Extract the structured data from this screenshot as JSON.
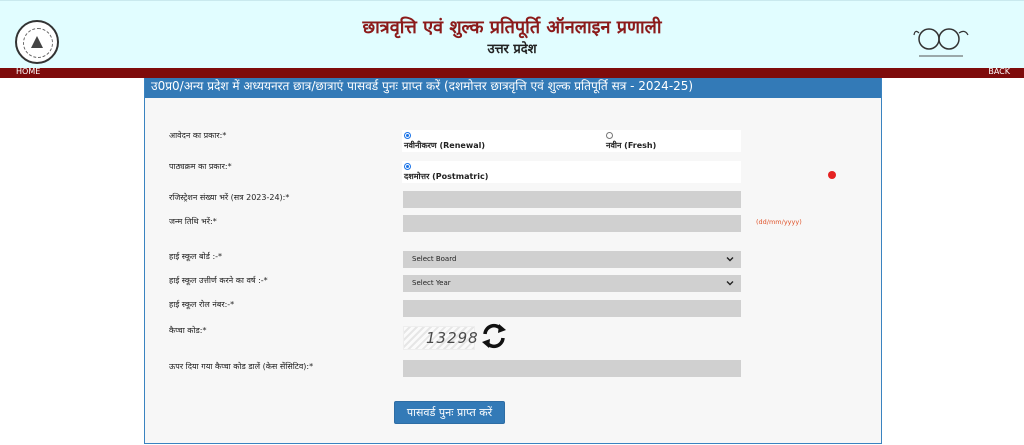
{
  "header": {
    "title": "छात्रवृत्ति एवं शुल्क प्रतिपूर्ति ऑनलाइन प्रणाली",
    "subtitle": "उत्तर प्रदेश"
  },
  "nav": {
    "home": "HOME",
    "back": "BACK"
  },
  "panel": {
    "heading": "उ0प्र0/अन्य प्रदेश में अध्ययनरत छात्र/छात्राएं पासवर्ड पुनः प्राप्त करें (दशमोत्तर छात्रवृत्ति एवं शुल्क प्रतिपूर्ति सत्र - 2024-25)"
  },
  "form": {
    "application_type_label": "आवेदन का प्रकार:*",
    "renewal_label": "नवीनीकरण (Renewal)",
    "fresh_label": "नवीन (Fresh)",
    "course_type_label": "पाठ्यक्रम का प्रकार:*",
    "postmatric_label": "दशमोत्तर (Postmatric)",
    "registration_label": "रजिस्ट्रेशन संख्या भरें (सत्र 2023-24):*",
    "dob_label": "जन्म तिथि भरें:*",
    "dob_hint": "(dd/mm/yyyy)",
    "board_label": "हाई स्कूल बोर्ड :-*",
    "board_value": "Select Board",
    "year_label": "हाई स्कूल उत्तीर्ण करने का वर्ष :-*",
    "year_value": "Select Year",
    "roll_label": "हाई स्कूल रोल नंबर:-*",
    "captcha_label": "कैप्चा कोड:*",
    "captcha_code": "13298",
    "captcha_input_label": "ऊपर दिया गया कैप्चा कोड डालें (केस सेंसिटिव):*",
    "submit_label": "पासवर्ड पुनः प्राप्त करें"
  },
  "colors": {
    "header_bg": "#e1fdff",
    "title": "#8b1a1a",
    "navbar": "#7e0b0b",
    "accent": "#337ab7",
    "hint": "#e0542b",
    "dot": "#e52222"
  }
}
